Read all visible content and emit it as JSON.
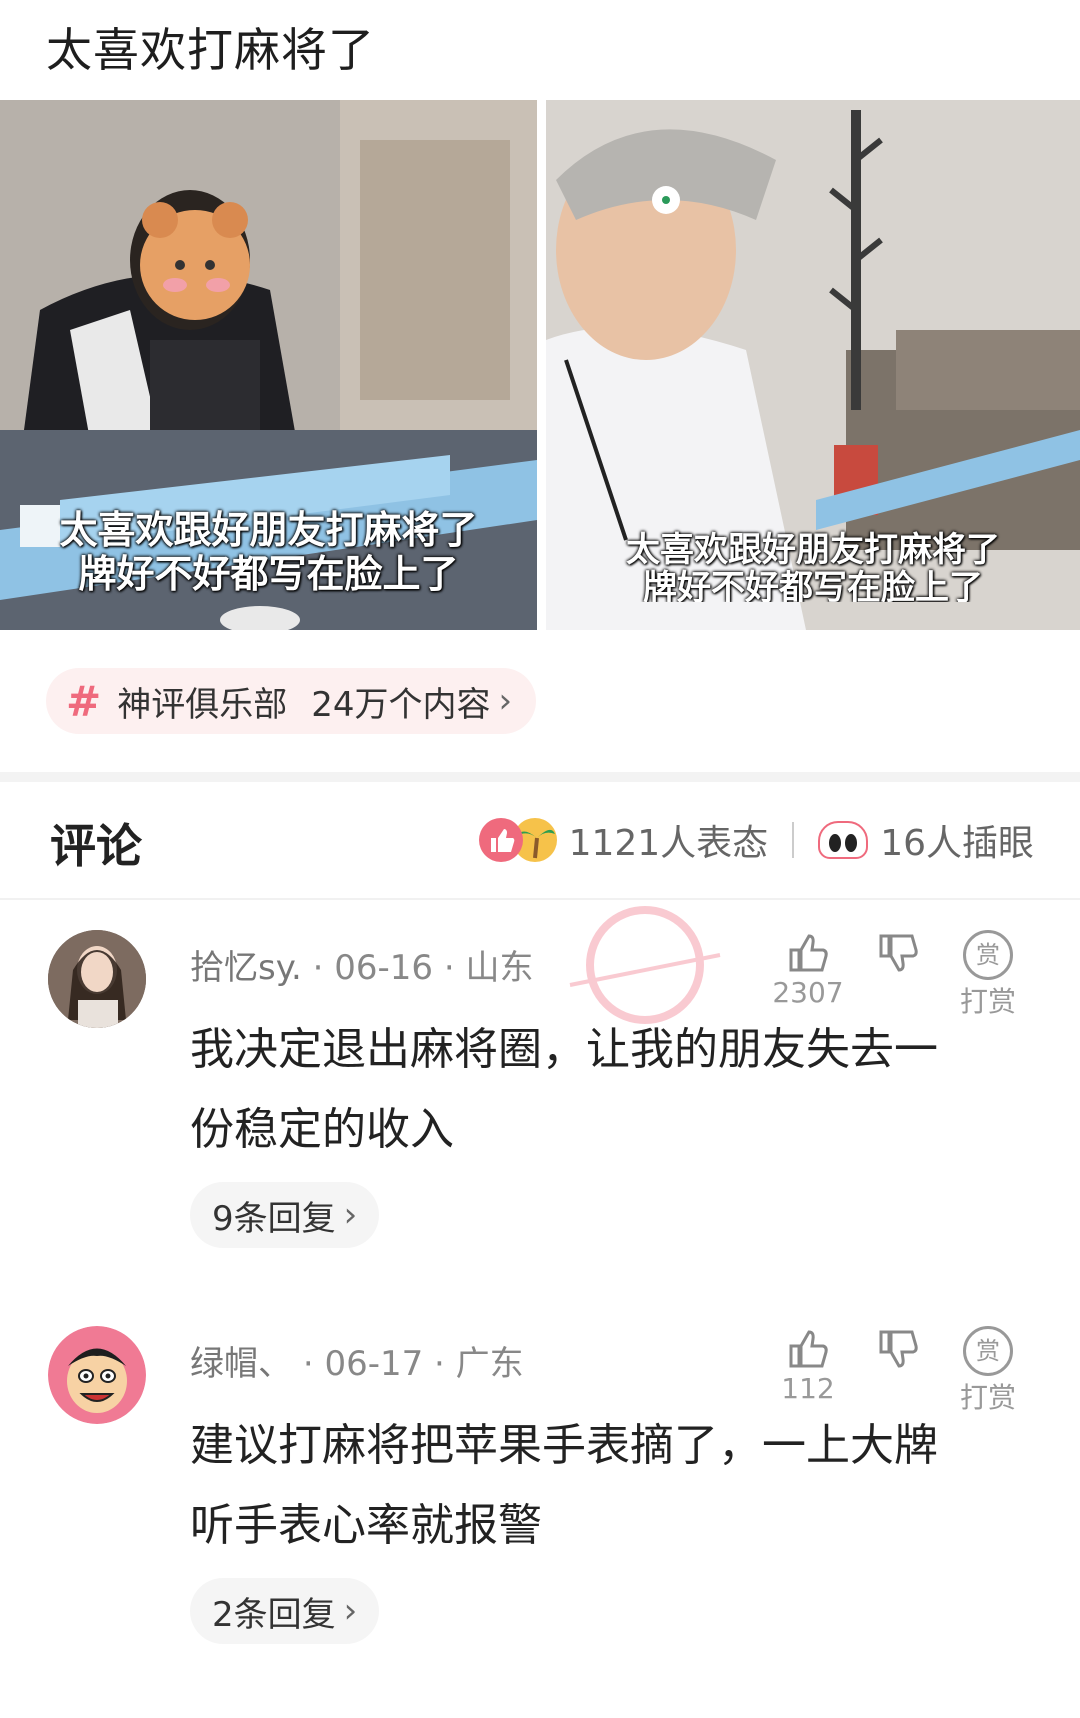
{
  "post": {
    "title": "太喜欢打麻将了",
    "captions": {
      "left_line1": "太喜欢跟好朋友打麻将了",
      "left_line2": "牌好不好都写在脸上了",
      "right_line1": "太喜欢跟好朋友打麻将了",
      "right_line2": "牌好不好都写在脸上了"
    }
  },
  "topic": {
    "icon": "hash-icon",
    "name": "神评俱乐部",
    "count": "24万个内容",
    "chevron": "›"
  },
  "comments_header": {
    "title": "评论",
    "reactions_text": "1121人表态",
    "eyes_text": "16人插眼"
  },
  "comments": [
    {
      "username": "拾忆sy.",
      "date": "06-16",
      "location": "山东",
      "sep": "·",
      "text_line1": "我决定退出麻将圈，让我的朋友失去一",
      "text_line2": "份稳定的收入",
      "likes": "2307",
      "reward_label": "打赏",
      "reward_icon_text": "赏",
      "replies": "9条回复",
      "reply_chevron": "›"
    },
    {
      "username": "绿帽、",
      "date": "06-17",
      "location": "广东",
      "sep": "·",
      "text_line1": "建议打麻将把苹果手表摘了，一上大牌",
      "text_line2": "听手表心率就报警",
      "likes": "112",
      "reward_label": "打赏",
      "reward_icon_text": "赏",
      "replies": "2条回复",
      "reply_chevron": "›"
    }
  ],
  "colors": {
    "accent_pink": "#ef6a7d",
    "pill_bg": "#fdf0f0",
    "reply_bg": "#f5f5f5"
  }
}
